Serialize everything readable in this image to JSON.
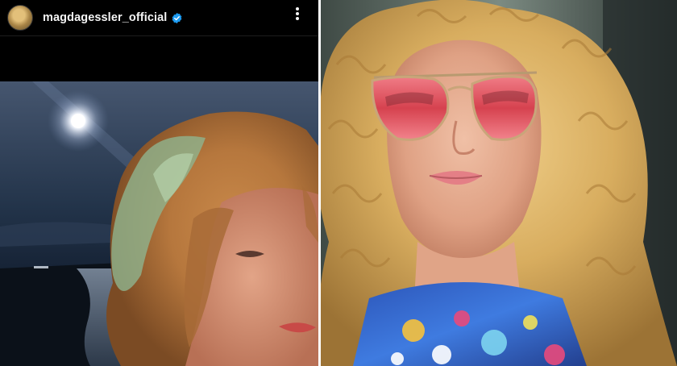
{
  "post": {
    "username": "magdagessler_official",
    "avatar_icon": "profile-avatar",
    "verified_icon": "verified-badge-icon",
    "more_icon": "more-options-icon"
  },
  "colors": {
    "header_bg": "#000000",
    "username_text": "#f5f5f5",
    "verified_blue": "#1d9bf0",
    "hair_blonde": "#d9b25f",
    "sunglasses_lens": "#e0505e",
    "night_sky": "#1f3048"
  }
}
